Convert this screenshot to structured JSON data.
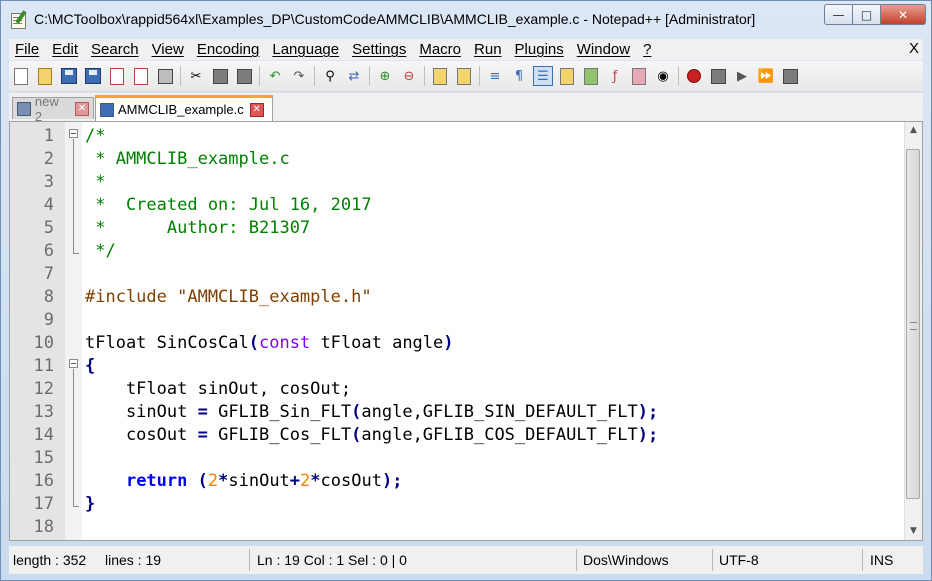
{
  "window": {
    "title": "C:\\MCToolbox\\rappid564xl\\Examples_DP\\CustomCodeAMMCLIB\\AMMCLIB_example.c - Notepad++ [Administrator]",
    "minimize": "—",
    "maximize": "□",
    "close": "✕"
  },
  "menu": {
    "items": [
      "File",
      "Edit",
      "Search",
      "View",
      "Encoding",
      "Language",
      "Settings",
      "Macro",
      "Run",
      "Plugins",
      "Window",
      "?"
    ],
    "close": "X"
  },
  "tabs": [
    {
      "label": "new 2",
      "active": false
    },
    {
      "label": "AMMCLIB_example.c",
      "active": true
    }
  ],
  "editor": {
    "line_numbers": [
      "1",
      "2",
      "3",
      "4",
      "5",
      "6",
      "7",
      "8",
      "9",
      "10",
      "11",
      "12",
      "13",
      "14",
      "15",
      "16",
      "17",
      "18"
    ],
    "lines": [
      [
        {
          "t": "/*",
          "c": "comment"
        }
      ],
      [
        {
          "t": " * AMMCLIB_example.c",
          "c": "comment"
        }
      ],
      [
        {
          "t": " *",
          "c": "comment"
        }
      ],
      [
        {
          "t": " *  Created on: Jul 16, 2017",
          "c": "comment"
        }
      ],
      [
        {
          "t": " *      Author: B21307",
          "c": "comment"
        }
      ],
      [
        {
          "t": " */",
          "c": "comment"
        }
      ],
      [],
      [
        {
          "t": "#include \"AMMCLIB_example.h\"",
          "c": "pre"
        }
      ],
      [],
      [
        {
          "t": "tFloat SinCosCal",
          "c": "id"
        },
        {
          "t": "(",
          "c": "op"
        },
        {
          "t": "const",
          "c": "type"
        },
        {
          "t": " tFloat angle",
          "c": "id"
        },
        {
          "t": ")",
          "c": "op"
        }
      ],
      [
        {
          "t": "{",
          "c": "op"
        }
      ],
      [
        {
          "t": "    tFloat sinOut, cosOut;",
          "c": "id"
        }
      ],
      [
        {
          "t": "    sinOut ",
          "c": "id"
        },
        {
          "t": "=",
          "c": "op"
        },
        {
          "t": " GFLIB_Sin_FLT",
          "c": "id"
        },
        {
          "t": "(",
          "c": "op"
        },
        {
          "t": "angle,GFLIB_SIN_DEFAULT_FLT",
          "c": "id"
        },
        {
          "t": ");",
          "c": "op"
        }
      ],
      [
        {
          "t": "    cosOut ",
          "c": "id"
        },
        {
          "t": "=",
          "c": "op"
        },
        {
          "t": " GFLIB_Cos_FLT",
          "c": "id"
        },
        {
          "t": "(",
          "c": "op"
        },
        {
          "t": "angle,GFLIB_COS_DEFAULT_FLT",
          "c": "id"
        },
        {
          "t": ");",
          "c": "op"
        }
      ],
      [],
      [
        {
          "t": "    ",
          "c": "id"
        },
        {
          "t": "return",
          "c": "kw"
        },
        {
          "t": " ",
          "c": "id"
        },
        {
          "t": "(",
          "c": "op"
        },
        {
          "t": "2",
          "c": "num"
        },
        {
          "t": "*",
          "c": "op"
        },
        {
          "t": "sinOut",
          "c": "id"
        },
        {
          "t": "+",
          "c": "op"
        },
        {
          "t": "2",
          "c": "num"
        },
        {
          "t": "*",
          "c": "op"
        },
        {
          "t": "cosOut",
          "c": "id"
        },
        {
          "t": ");",
          "c": "op"
        }
      ],
      [
        {
          "t": "}",
          "c": "op"
        }
      ],
      []
    ]
  },
  "status": {
    "length": "length : 352",
    "lines": "lines : 19",
    "position": "Ln : 19    Col : 1    Sel : 0 | 0",
    "eol": "Dos\\Windows",
    "encoding": "UTF-8",
    "mode": "INS"
  },
  "colors": {
    "comment": "#008000",
    "preprocessor": "#804000",
    "keyword": "#0000ff",
    "type": "#8000ff",
    "operator": "#000080",
    "number": "#ff8000",
    "active_tab_accent": "#f2a530"
  }
}
